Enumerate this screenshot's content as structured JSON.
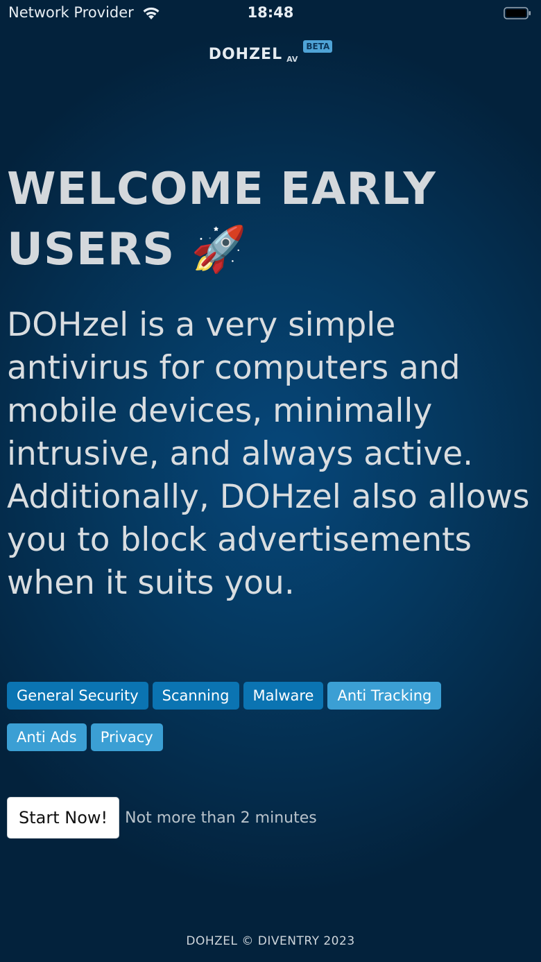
{
  "status_bar": {
    "carrier": "Network Provider",
    "time": "18:48",
    "wifi_icon": "wifi-icon",
    "battery_icon": "battery-icon"
  },
  "brand": {
    "name": "DOHZEL",
    "sub": "AV",
    "badge": "BETA",
    "badge_color": "#4fa3d6"
  },
  "hero": {
    "title": "WELCOME EARLY USERS 🚀",
    "description": "DOHzel is a very simple antivirus for computers and mobile devices, minimally intrusive, and always active. Additionally, DOHzel also allows you to block advertisements when it suits you."
  },
  "tags": [
    {
      "label": "General Security",
      "color": "#0b74b2"
    },
    {
      "label": "Scanning",
      "color": "#0b74b2"
    },
    {
      "label": "Malware",
      "color": "#0b74b2"
    },
    {
      "label": "Anti Tracking",
      "color": "#3b9fd4"
    },
    {
      "label": "Anti Ads",
      "color": "#3b9fd4"
    },
    {
      "label": "Privacy",
      "color": "#3b9fd4"
    }
  ],
  "cta": {
    "button_label": "Start Now!",
    "note": "Not more than 2 minutes"
  },
  "footer": {
    "text": "DOHZEL © DIVENTRY 2023"
  },
  "colors": {
    "background": "#05385f",
    "accent": "#0b74b2"
  }
}
